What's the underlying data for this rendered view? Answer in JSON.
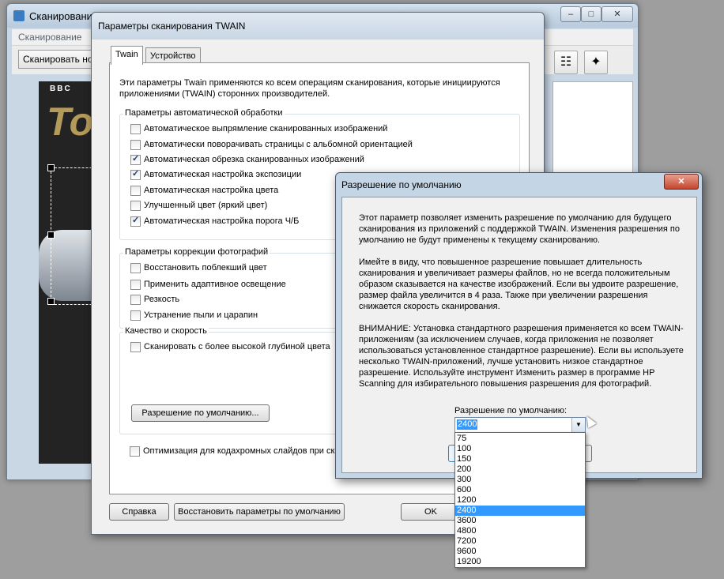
{
  "main_window": {
    "title": "Сканирование HP",
    "menu": "Сканирование",
    "scan_button": "Сканировать нов",
    "min_btn": "–",
    "max_btn": "□",
    "close_btn": "✕",
    "bbc_text": "BBC",
    "magazine_title": "Top"
  },
  "twain": {
    "title": "Параметры сканирования TWAIN",
    "tabs": [
      "Twain",
      "Устройство"
    ],
    "intro": "Эти параметры Twain применяются ко всем операциям сканирования, которые инициируются приложениями (TWAIN) сторонних производителей.",
    "auto_group": {
      "title": "Параметры автоматической обработки",
      "items": [
        {
          "label": "Автоматическое выпрямление сканированных изображений",
          "checked": false
        },
        {
          "label": "Автоматически поворачивать страницы с альбомной ориентацией",
          "checked": false
        },
        {
          "label": "Автоматическая обрезка сканированных изображений",
          "checked": true
        },
        {
          "label": "Автоматическая настройка экспозиции",
          "checked": true
        },
        {
          "label": "Автоматическая настройка цвета",
          "checked": false
        },
        {
          "label": "Улучшенный цвет (яркий цвет)",
          "checked": false
        },
        {
          "label": "Автоматическая настройка порога Ч/Б",
          "checked": true
        }
      ]
    },
    "photo_group": {
      "title": "Параметры коррекции фотографий",
      "items": [
        {
          "label": "Восстановить поблекший цвет",
          "checked": false
        },
        {
          "label": "Применить адаптивное освещение",
          "checked": false
        },
        {
          "label": "Резкость",
          "checked": false
        },
        {
          "label": "Устранение пыли и царапин",
          "checked": false
        }
      ]
    },
    "quality_group": {
      "title": "Качество и скорость",
      "items": [
        {
          "label": "Сканировать с более высокой глубиной цвета",
          "checked": false
        }
      ],
      "default_res_button": "Разрешение по умолчанию..."
    },
    "kodachrome": {
      "label": "Оптимизация для кодахромных слайдов при ска",
      "checked": false
    },
    "buttons": {
      "help": "Справка",
      "restore": "Восстановить параметры по умолчанию",
      "ok": "OK"
    }
  },
  "resolution_dialog": {
    "title": "Разрешение по умолчанию",
    "close": "✕",
    "paragraph1": "Этот параметр позволяет изменить разрешение по умолчанию для будущего сканирования из приложений с поддержкой TWAIN. Изменения разрешения по умолчанию не будут применены к текущему сканированию.",
    "paragraph2": "Имейте в виду, что повышенное разрешение повышает длительность сканирования и увеличивает размеры файлов, но не всегда положительным образом сказывается на качестве изображений. Если вы удвоите разрешение, размер файла увеличится в 4 раза. Также при увеличении разрешения снижается скорость сканирования.",
    "paragraph3": "ВНИМАНИЕ: Установка стандартного разрешения применяется ко всем TWAIN-приложениям (за исключением случаев, когда приложения не позволяет использоваться установленное стандартное разрешение). Если вы используете несколько TWAIN-приложений, лучше установить низкое стандартное разрешение. Используйте инструмент Изменить размер в программе HP Scanning для избирательного повышения разрешения для фотографий.",
    "select_label": "Разрешение по умолчанию:",
    "selected_value": "2400",
    "arrow": "▼",
    "options": [
      "75",
      "100",
      "150",
      "200",
      "300",
      "600",
      "1200",
      "2400",
      "3600",
      "4800",
      "7200",
      "9600",
      "19200"
    ]
  },
  "colors": {
    "accent": "#3399ff",
    "close_red": "#c4452d",
    "dialog_frame": "#c4d5e6"
  },
  "icons": [
    "settings-sliders-icon",
    "magic-wand-icon",
    "app-icon"
  ]
}
